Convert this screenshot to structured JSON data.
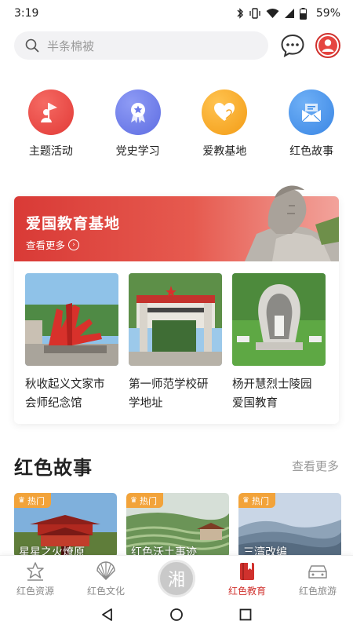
{
  "status_bar": {
    "time": "3:19",
    "battery": "59%"
  },
  "search": {
    "placeholder": "半条棉被"
  },
  "quick_nav": [
    {
      "label": "主题活动",
      "icon": "person-flag-icon",
      "color": "#e8413f"
    },
    {
      "label": "党史学习",
      "icon": "medal-icon",
      "color": "#6c7bea"
    },
    {
      "label": "爱教基地",
      "icon": "heart-icon",
      "color": "#f5a522"
    },
    {
      "label": "红色故事",
      "icon": "mail-icon",
      "color": "#3e8ee8"
    }
  ],
  "edu": {
    "title": "爱国教育基地",
    "more": "查看更多",
    "items": [
      {
        "name_line1": "秋收起义文家市",
        "name_line2": "会师纪念馆"
      },
      {
        "name_line1": "第一师范学校研",
        "name_line2": "学地址"
      },
      {
        "name_line1": "杨开慧烈士陵园",
        "name_line2": "爱国教育"
      }
    ]
  },
  "stories": {
    "title": "红色故事",
    "more": "查看更多",
    "hot_label": "热门",
    "items": [
      {
        "caption": "星星之火燎原"
      },
      {
        "caption": "红色沃土事迹"
      },
      {
        "caption": "三湾改编"
      }
    ]
  },
  "tabs": [
    {
      "label": "红色资源",
      "icon": "star-house-icon"
    },
    {
      "label": "红色文化",
      "icon": "fan-icon"
    },
    {
      "label": "湘",
      "icon": "center-logo"
    },
    {
      "label": "红色教育",
      "icon": "book-icon",
      "active": true
    },
    {
      "label": "红色旅游",
      "icon": "car-icon"
    }
  ],
  "colors": {
    "accent": "#d0312d",
    "hot": "#f2a33a"
  }
}
